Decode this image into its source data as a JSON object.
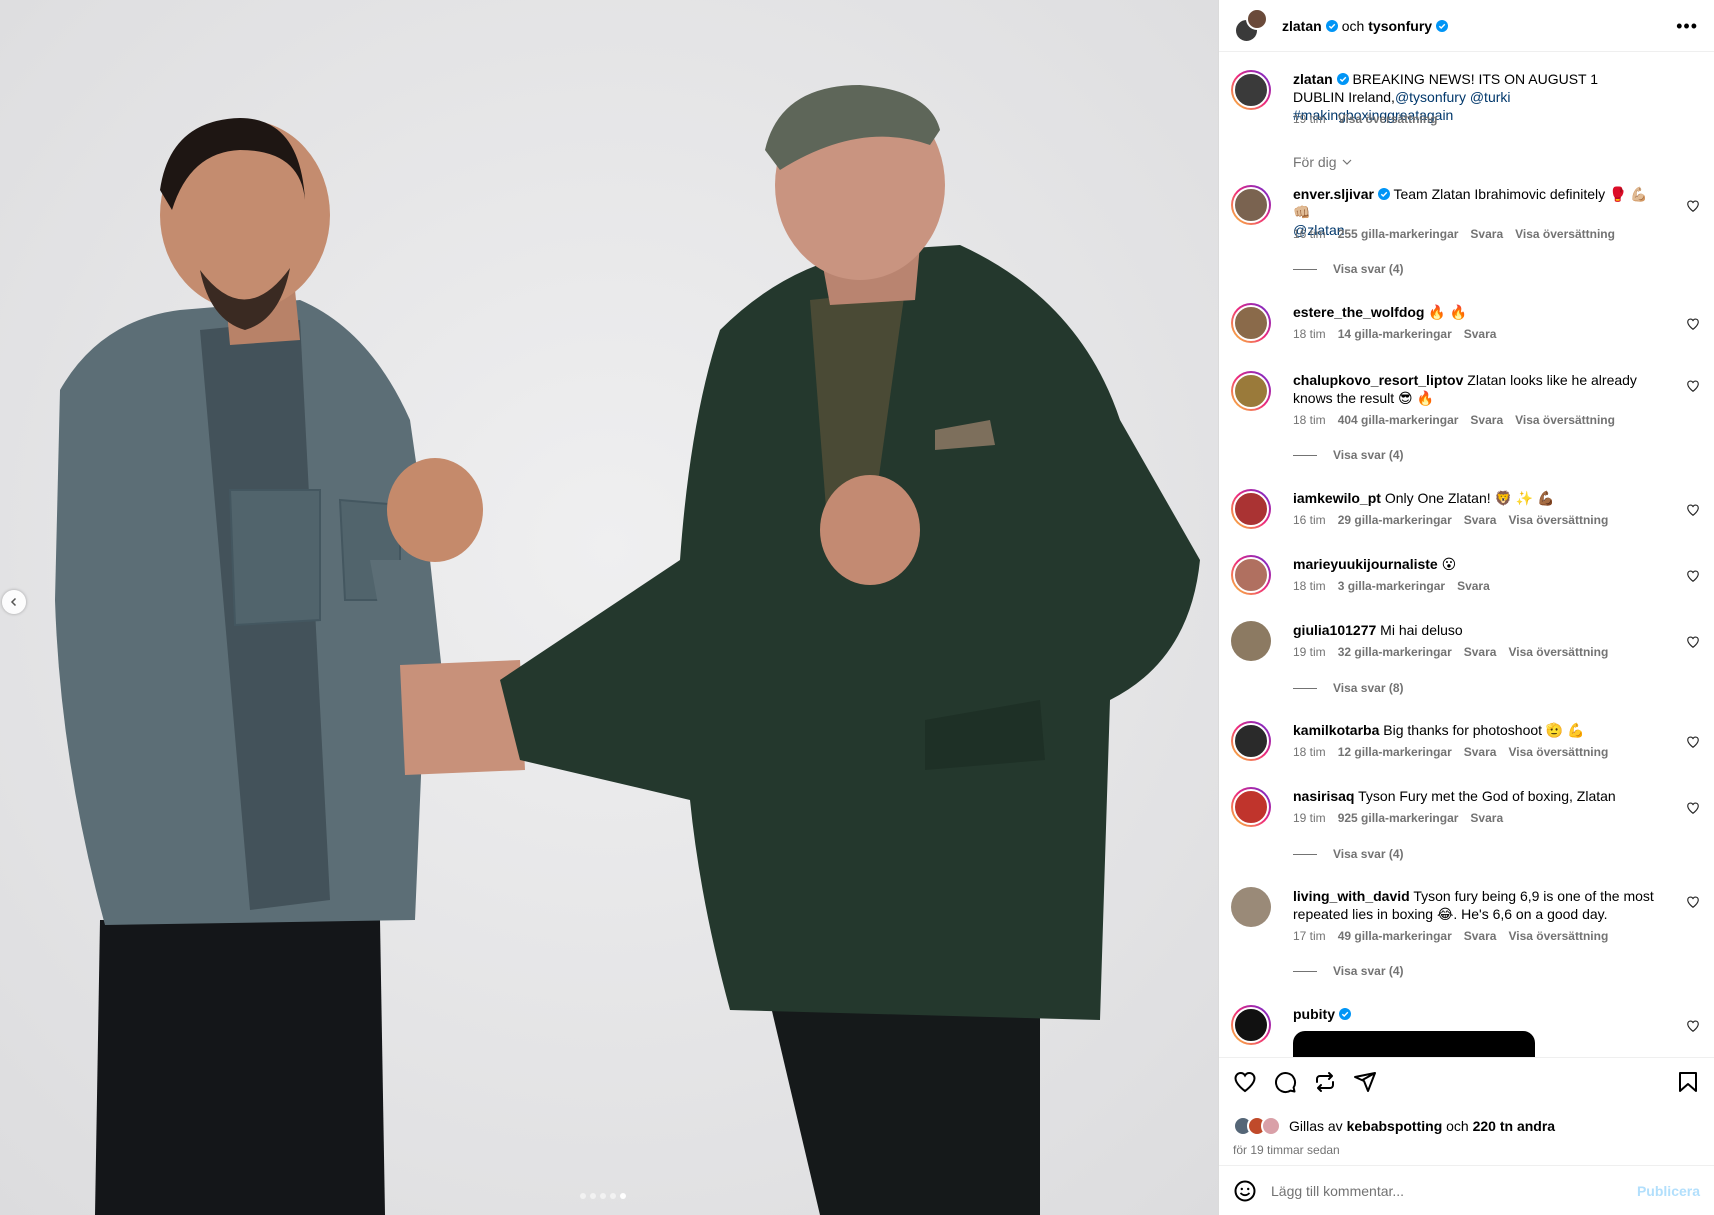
{
  "header": {
    "user1": "zlatan",
    "conjunction": "och",
    "user2": "tysonfury",
    "more": "•••"
  },
  "caption": {
    "username": "zlatan",
    "text": "BREAKING NEWS! ITS ON AUGUST 1 DUBLIN Ireland,",
    "tags": "@tysonfury @turki #makingboxinggreatagain",
    "time": "19 tim",
    "translate": "Visa översättning"
  },
  "sort_label": "För dig",
  "comments": [
    {
      "username": "enver.sljivar",
      "text": "Team Zlatan Ibrahimovic definitely 🥊 💪🏼 👊🏼",
      "mention": "@zlatan",
      "time": "16 tim",
      "likes": "255 gilla-markeringar",
      "reply": "Svara",
      "translate": "Visa översättning",
      "replies": "Visa svar (4)"
    },
    {
      "username": "estere_the_wolfdog",
      "text": "🔥 🔥",
      "time": "18 tim",
      "likes": "14 gilla-markeringar",
      "reply": "Svara"
    },
    {
      "username": "chalupkovo_resort_liptov",
      "text": "Zlatan looks like he already knows the result 😎 🔥",
      "time": "18 tim",
      "likes": "404 gilla-markeringar",
      "reply": "Svara",
      "translate": "Visa översättning",
      "replies": "Visa svar (4)"
    },
    {
      "username": "iamkewilo_pt",
      "text": "Only One Zlatan! 🦁 ✨ 💪🏾",
      "time": "16 tim",
      "likes": "29 gilla-markeringar",
      "reply": "Svara",
      "translate": "Visa översättning"
    },
    {
      "username": "marieyuukijournaliste",
      "text": "😮",
      "time": "18 tim",
      "likes": "3 gilla-markeringar",
      "reply": "Svara"
    },
    {
      "username": "giulia101277",
      "text": "Mi hai deluso",
      "time": "19 tim",
      "likes": "32 gilla-markeringar",
      "reply": "Svara",
      "translate": "Visa översättning",
      "replies": "Visa svar (8)"
    },
    {
      "username": "kamilkotarba",
      "text": "Big thanks for photoshoot 🫡 💪",
      "time": "18 tim",
      "likes": "12 gilla-markeringar",
      "reply": "Svara",
      "translate": "Visa översättning"
    },
    {
      "username": "nasirisaq",
      "text": "Tyson Fury met the God of boxing, Zlatan",
      "time": "19 tim",
      "likes": "925 gilla-markeringar",
      "reply": "Svara",
      "replies": "Visa svar (4)"
    },
    {
      "username": "living_with_david",
      "text": "Tyson fury being 6,9 is one of the most repeated lies in boxing 😂. He's 6,6 on a good day.",
      "time": "17 tim",
      "likes": "49 gilla-markeringar",
      "reply": "Svara",
      "translate": "Visa översättning",
      "replies": "Visa svar (4)"
    },
    {
      "username": "pubity",
      "text": ""
    }
  ],
  "likes_line": {
    "prefix": "Gillas av",
    "user": "kebabspotting",
    "mid": "och",
    "count": "220 tn andra"
  },
  "time_ago": "för 19 timmar sedan",
  "add_comment": {
    "placeholder": "Lägg till kommentar...",
    "publish": "Publicera"
  },
  "colors": {
    "link": "#00376b",
    "verified": "#0095f6",
    "publish_disabled": "#b2dffc"
  },
  "carousel": {
    "slides": 5,
    "active_index": 4
  }
}
